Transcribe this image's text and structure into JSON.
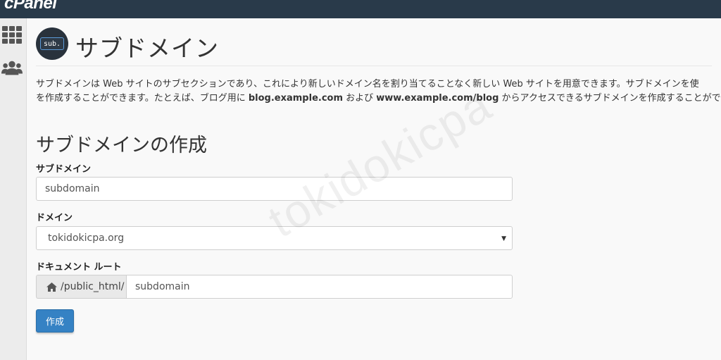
{
  "app": {
    "logo_text": "cPanel"
  },
  "sidebar": {
    "items": [
      {
        "icon": "apps-grid-icon"
      },
      {
        "icon": "users-icon"
      }
    ]
  },
  "header": {
    "logo_text": "sub.",
    "title": "サブドメイン"
  },
  "description": {
    "line1": "サブドメインは Web サイトのサブセクションであり、これにより新しいドメイン名を割り当てることなく新しい Web サイトを用意できます。サブドメインを使",
    "line2_a": "を作成することができます。たとえば、ブログ用に ",
    "line2_b": "blog.example.com",
    "line2_c": " および ",
    "line2_d": "www.example.com/blog",
    "line2_e": " からアクセスできるサブドメインを作成することができ"
  },
  "form": {
    "section_title": "サブドメインの作成",
    "subdomain_label": "サブドメイン",
    "subdomain_value": "subdomain",
    "domain_label": "ドメイン",
    "domain_value": "tokidokicpa.org",
    "docroot_label": "ドキュメント ルート",
    "docroot_prefix": "/public_html/",
    "docroot_value": "subdomain",
    "submit_label": "作成"
  },
  "watermark": "tokidokicpa",
  "colors": {
    "topbar": "#293a4a",
    "primary_button": "#3582c4"
  }
}
